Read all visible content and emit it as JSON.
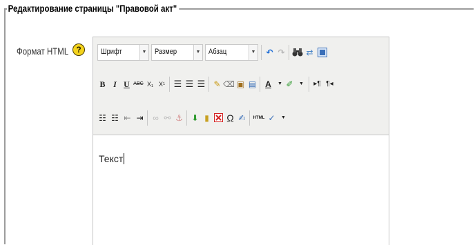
{
  "fieldset": {
    "legend": "Редактирование страницы \"Правовой акт\""
  },
  "field": {
    "label": "Формат HTML",
    "help_glyph": "?"
  },
  "toolbar": {
    "font_select": "Шрифт",
    "size_select": "Размер",
    "format_select": "Абзац",
    "bold": "B",
    "italic": "I",
    "underline": "U",
    "strikethrough": "ABC",
    "subscript": "X₁",
    "superscript": "X¹",
    "special_char": "Ω",
    "html_label": "HTML"
  },
  "editor": {
    "content": "Текст"
  },
  "colors": {
    "toolbar_bg": "#f0f0ee",
    "border": "#c4c4c4",
    "help_icon": "#f4d31c",
    "undo_blue": "#1a6bd6",
    "red": "#d42020",
    "green": "#2f9a2f"
  }
}
